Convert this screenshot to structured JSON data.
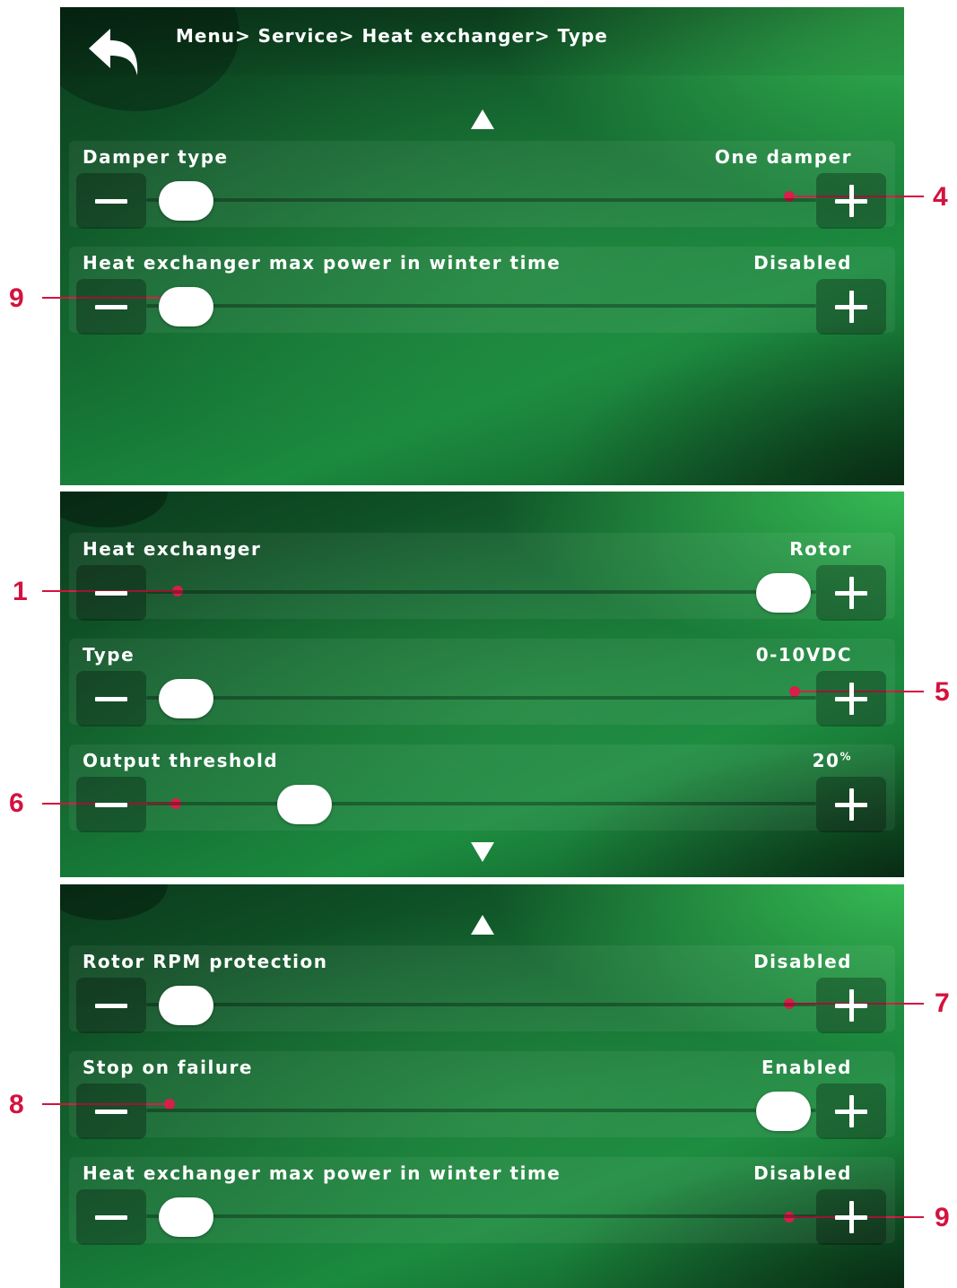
{
  "header": {
    "breadcrumb": "Menu> Service> Heat exchanger> Type"
  },
  "icons": {
    "back": "back-arrow-icon",
    "scroll_up": "triangle-up-icon",
    "scroll_down": "triangle-down-icon"
  },
  "colors": {
    "accent_green": "#1a8a3e",
    "callout_red": "#d4123e",
    "knob": "#ffffff"
  },
  "panel1": {
    "rows": [
      {
        "label": "Damper type",
        "value": "One damper"
      },
      {
        "label": "Heat exchanger max power in winter time",
        "value": "Disabled"
      }
    ]
  },
  "panel2": {
    "rows": [
      {
        "label": "Heat exchanger",
        "value": "Rotor"
      },
      {
        "label": "Type",
        "value": "0-10VDC"
      },
      {
        "label": "Output threshold",
        "value": "20",
        "unit": "%"
      }
    ]
  },
  "panel3": {
    "rows": [
      {
        "label": "Rotor RPM protection",
        "value": "Disabled"
      },
      {
        "label": "Stop on failure",
        "value": "Enabled"
      },
      {
        "label": "Heat exchanger max power in winter time",
        "value": "Disabled"
      }
    ]
  },
  "callouts": {
    "c4": "4",
    "c9a": "9",
    "c1": "1",
    "c5": "5",
    "c6": "6",
    "c7": "7",
    "c8": "8",
    "c9b": "9"
  }
}
